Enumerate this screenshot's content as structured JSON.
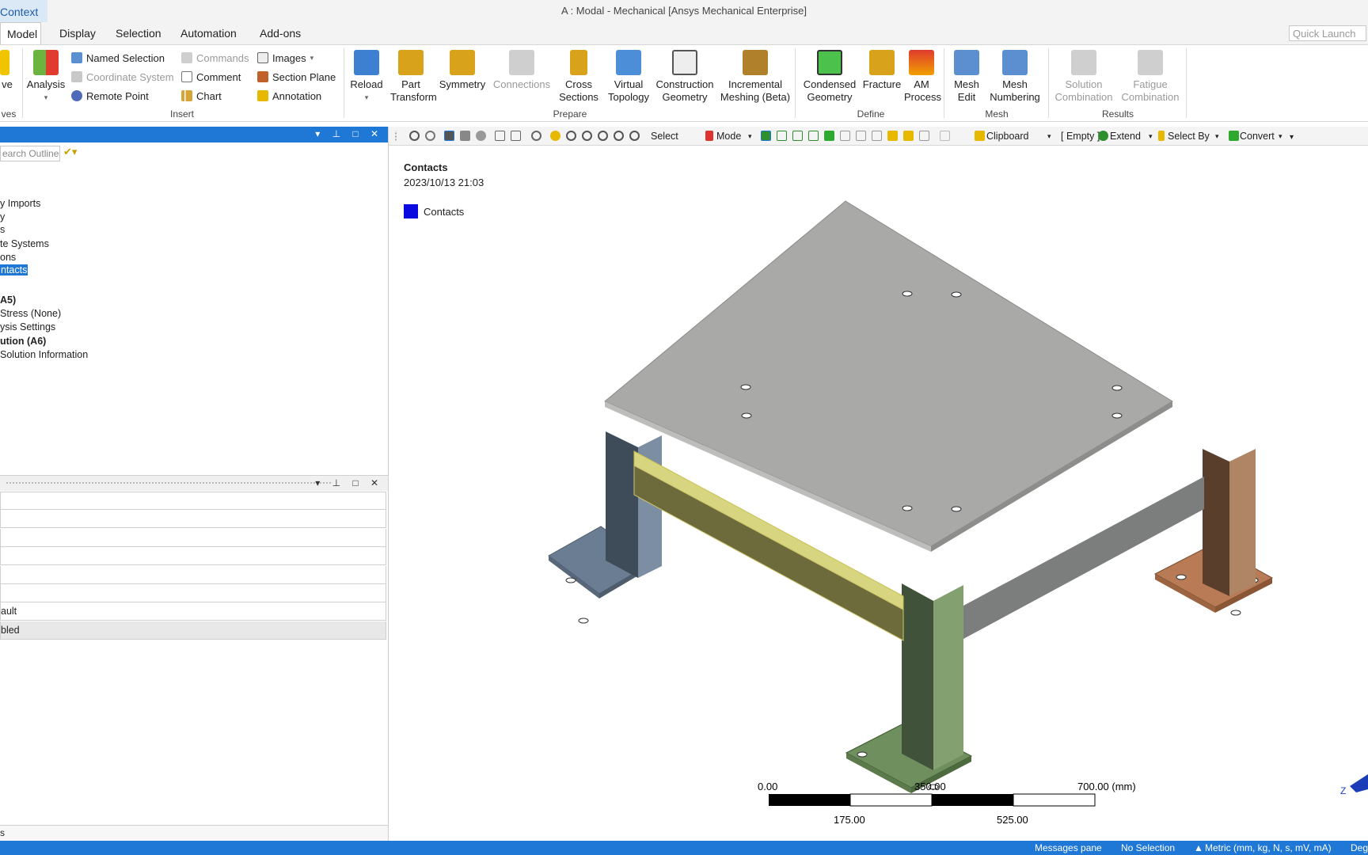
{
  "title_bar": {
    "context_tab": "Context",
    "window_title": "A : Modal - Mechanical [Ansys Mechanical Enterprise]"
  },
  "menu": {
    "tabs": [
      "Model",
      "Display",
      "Selection",
      "Automation",
      "Add-ons"
    ],
    "active": "Model",
    "quick_launch_placeholder": "Quick Launch"
  },
  "ribbon": {
    "solve_fragment": "ve",
    "solve_group_fragment": "ves",
    "analysis": "Analysis",
    "insert": {
      "named_selection": "Named Selection",
      "coordinate_system": "Coordinate System",
      "remote_point": "Remote Point",
      "commands": "Commands",
      "comment": "Comment",
      "chart": "Chart",
      "images": "Images",
      "section_plane": "Section Plane",
      "annotation": "Annotation",
      "group": "Insert"
    },
    "prepare": {
      "reload": "Reload",
      "part_transform_1": "Part",
      "part_transform_2": "Transform",
      "symmetry": "Symmetry",
      "connections": "Connections",
      "cross_sections_1": "Cross",
      "cross_sections_2": "Sections",
      "virtual_topology_1": "Virtual",
      "virtual_topology_2": "Topology",
      "construction_geometry_1": "Construction",
      "construction_geometry_2": "Geometry",
      "incremental_meshing_1": "Incremental",
      "incremental_meshing_2": "Meshing (Beta)",
      "group": "Prepare"
    },
    "define": {
      "condensed_geometry_1": "Condensed",
      "condensed_geometry_2": "Geometry",
      "fracture": "Fracture",
      "am_process_1": "AM",
      "am_process_2": "Process",
      "group": "Define"
    },
    "mesh": {
      "mesh_edit_1": "Mesh",
      "mesh_edit_2": "Edit",
      "mesh_numbering_1": "Mesh",
      "mesh_numbering_2": "Numbering",
      "group": "Mesh"
    },
    "results": {
      "solution_combination_1": "Solution",
      "solution_combination_2": "Combination",
      "fatigue_combination_1": "Fatigue",
      "fatigue_combination_2": "Combination",
      "group": "Results"
    }
  },
  "outline": {
    "search_placeholder": "earch Outline",
    "tree": [
      {
        "label": "y Imports",
        "style": "normal"
      },
      {
        "label": "y",
        "style": "normal"
      },
      {
        "label": "s",
        "style": "normal"
      },
      {
        "label": "te Systems",
        "style": "normal"
      },
      {
        "label": "ons",
        "style": "normal"
      },
      {
        "label": "ntacts",
        "style": "selected"
      },
      {
        "label": "A5)",
        "style": "bold"
      },
      {
        "label": "Stress (None)",
        "style": "normal"
      },
      {
        "label": "ysis Settings",
        "style": "normal"
      },
      {
        "label": "ution (A6)",
        "style": "bold"
      },
      {
        "label": "Solution Information",
        "style": "normal"
      }
    ]
  },
  "details": {
    "rows": [
      "",
      "",
      "",
      "",
      "",
      "",
      "ault",
      "bled"
    ],
    "bottom_fragment": "s"
  },
  "graphics_toolbar": {
    "select": "Select",
    "mode": "Mode",
    "clipboard": "Clipboard",
    "empty": "[ Empty ]",
    "extend": "Extend",
    "select_by": "Select By",
    "convert": "Convert"
  },
  "viewport": {
    "title": "Contacts",
    "date": "2023/10/13 21:03",
    "legend_label": "Contacts",
    "legend_color": "#0a0ae0",
    "scale": {
      "top_labels": [
        "0.00",
        "350.00",
        "700.00 (mm)"
      ],
      "bottom_labels": [
        "175.00",
        "525.00"
      ]
    },
    "triad_label": "Z"
  },
  "status": {
    "messages_pane": "Messages pane",
    "selection": "No Selection",
    "units": "Metric (mm, kg, N, s, mV, mA)",
    "degrees": "Deg"
  },
  "colors": {
    "accent_blue": "#1f78d6",
    "plate_gray": "#a9aaa8",
    "leg_blue_gray": "#6f8196",
    "leg_green": "#6f8f5e",
    "leg_copper": "#b37a54",
    "beam_yellow": "#69693a"
  }
}
